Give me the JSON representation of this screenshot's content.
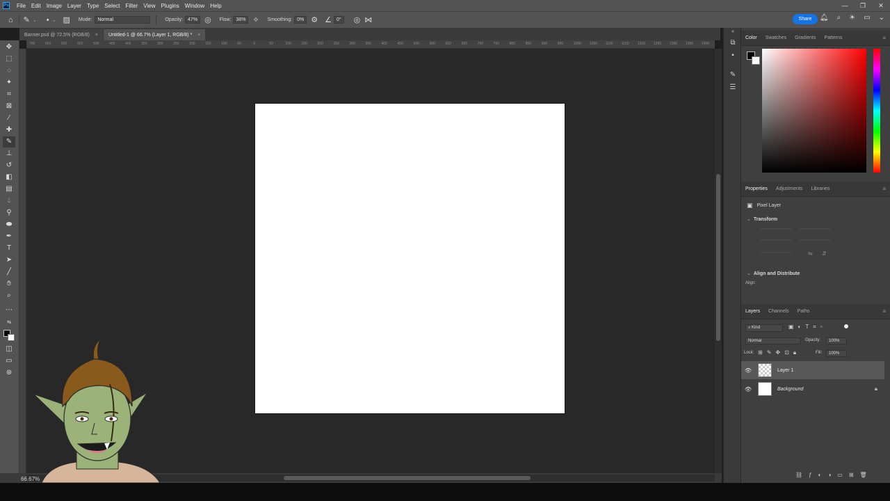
{
  "app": {
    "logo": "Ps"
  },
  "menu": [
    "File",
    "Edit",
    "Image",
    "Layer",
    "Type",
    "Select",
    "Filter",
    "View",
    "Plugins",
    "Window",
    "Help"
  ],
  "window_controls": [
    "—",
    "❐",
    "✕"
  ],
  "options": {
    "mode_label": "Mode:",
    "mode_value": "Normal",
    "opacity_label": "Opacity:",
    "opacity_value": "47%",
    "flow_label": "Flow:",
    "flow_value": "38%",
    "smoothing_label": "Smoothing:",
    "smoothing_value": "0%",
    "angle_value": "0°"
  },
  "share_label": "Share",
  "tabs": [
    {
      "label": "Banner.psd @ 72.5% (RGB/8)",
      "active": false
    },
    {
      "label": "Untitled-1 @ 66.7% (Layer 1, RGB/8) *",
      "active": true
    }
  ],
  "ruler_ticks": [
    "700",
    "650",
    "600",
    "550",
    "500",
    "450",
    "400",
    "350",
    "300",
    "250",
    "200",
    "150",
    "100",
    "50",
    "0",
    "50",
    "100",
    "150",
    "200",
    "250",
    "300",
    "350",
    "400",
    "450",
    "500",
    "550",
    "600",
    "650",
    "700",
    "750",
    "800",
    "850",
    "900",
    "950",
    "1000",
    "1050",
    "1100",
    "1150",
    "1200",
    "1250",
    "1300",
    "1350",
    "1400"
  ],
  "status": {
    "zoom": "66.67%"
  },
  "color_panel": {
    "tabs": [
      "Color",
      "Swatches",
      "Gradients",
      "Patterns"
    ],
    "active": 0
  },
  "properties_panel": {
    "tabs": [
      "Properties",
      "Adjustments",
      "Libraries"
    ],
    "active": 0,
    "layer_type": "Pixel Layer",
    "transform_heading": "Transform",
    "align_heading": "Align and Distribute",
    "align_label": "Align:"
  },
  "layers_panel": {
    "tabs": [
      "Layers",
      "Channels",
      "Paths"
    ],
    "active": 0,
    "filter_kind": "Kind",
    "blend_mode": "Normal",
    "opacity_label": "Opacity:",
    "opacity_value": "100%",
    "lock_label": "Lock:",
    "fill_label": "Fill:",
    "fill_value": "100%",
    "layers": [
      {
        "name": "Layer 1",
        "selected": true
      },
      {
        "name": "Background",
        "selected": false
      }
    ]
  },
  "colors": {
    "chrome": "#535353",
    "workspace": "#282828",
    "panel": "#3f3f3f",
    "accent": "#1473e6"
  }
}
